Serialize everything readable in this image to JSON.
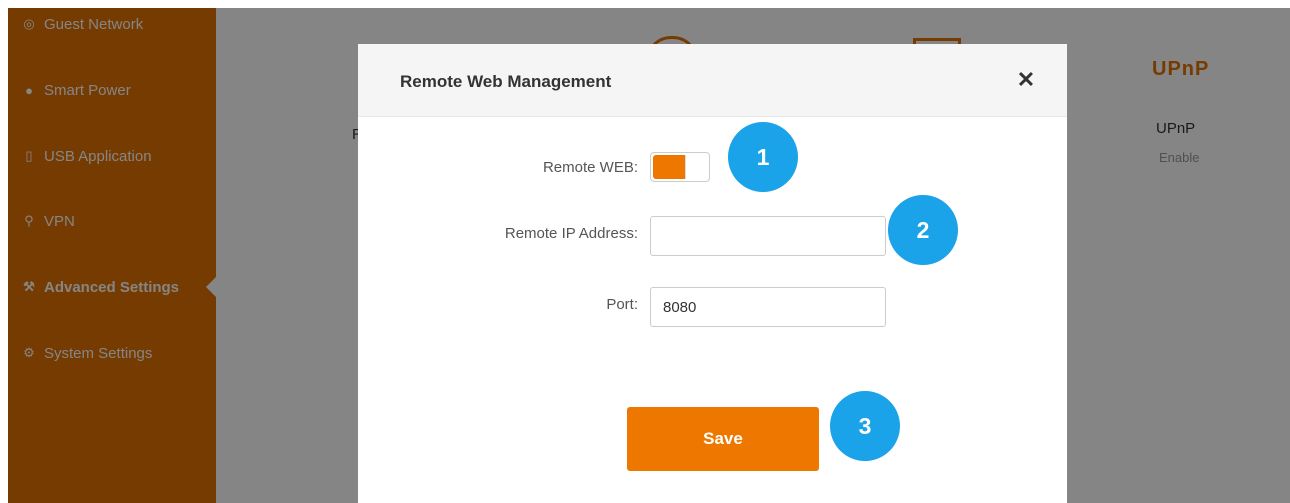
{
  "sidebar": {
    "items": [
      {
        "label": "Guest Network",
        "icon": "wifi-icon"
      },
      {
        "label": "Smart Power",
        "icon": "bulb-icon"
      },
      {
        "label": "USB Application",
        "icon": "usb-icon"
      },
      {
        "label": "VPN",
        "icon": "vpn-icon"
      },
      {
        "label": "Advanced Settings",
        "icon": "wrench-icon",
        "active": true
      },
      {
        "label": "System Settings",
        "icon": "gear-icon"
      }
    ]
  },
  "background": {
    "partial_label": "R",
    "upnp_logo": "UPnP",
    "upnp_title": "UPnP",
    "upnp_status": "Enable"
  },
  "modal": {
    "title": "Remote Web Management",
    "close_icon": "close-icon",
    "fields": {
      "remote_web_label": "Remote WEB:",
      "remote_web_enabled": true,
      "remote_ip_label": "Remote IP Address:",
      "remote_ip_value": "",
      "port_label": "Port:",
      "port_value": "8080"
    },
    "save_label": "Save"
  },
  "steps": [
    "1",
    "2",
    "3"
  ],
  "colors": {
    "accent": "#ee7700",
    "sidebar": "#e37200",
    "step_badge": "#1aa3e8"
  }
}
